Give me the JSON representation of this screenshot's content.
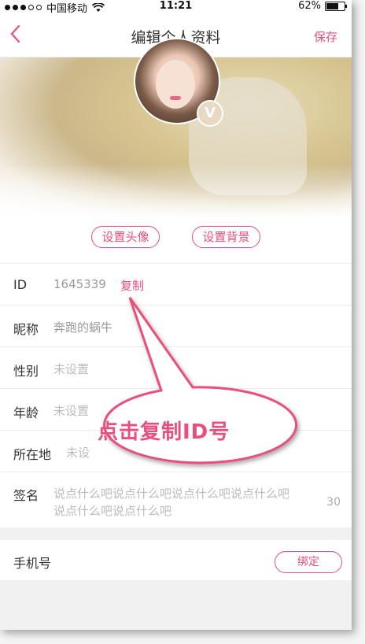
{
  "status": {
    "carrier": "中国移动",
    "time": "11:21",
    "battery": "62%",
    "battery_level": 0.62
  },
  "nav": {
    "back_icon": "chevron-left-icon",
    "title": "编辑个人资料",
    "save": "保存"
  },
  "profile": {
    "badge": "V",
    "set_avatar": "设置头像",
    "set_background": "设置背景"
  },
  "fields": {
    "id": {
      "label": "ID",
      "value": "1645339",
      "copy": "复制"
    },
    "nickname": {
      "label": "昵称",
      "value": "奔跑的蜗牛"
    },
    "gender": {
      "label": "性别",
      "placeholder": "未设置"
    },
    "age": {
      "label": "年龄",
      "placeholder": "未设置"
    },
    "location": {
      "label": "所在地",
      "placeholder": "未设"
    },
    "signature": {
      "label": "签名",
      "line1": "说点什么吧说点什么吧说点什么吧说点什么吧",
      "line2": "说点什么吧说点什么吧",
      "counter": "30"
    },
    "phone": {
      "label": "手机号",
      "bind": "绑定"
    }
  },
  "callout": {
    "text": "点击复制ID号"
  },
  "colors": {
    "accent": "#e84f7d",
    "text": "#333333",
    "muted": "#999999"
  }
}
